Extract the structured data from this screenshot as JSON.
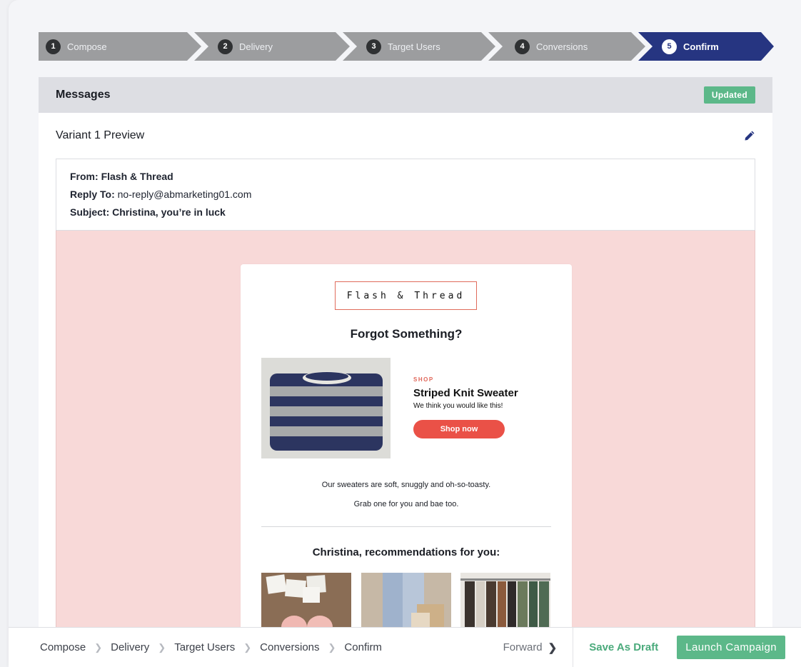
{
  "stepper": {
    "steps": [
      {
        "num": "1",
        "label": "Compose"
      },
      {
        "num": "2",
        "label": "Delivery"
      },
      {
        "num": "3",
        "label": "Target Users"
      },
      {
        "num": "4",
        "label": "Conversions"
      },
      {
        "num": "5",
        "label": "Confirm"
      }
    ],
    "active_step": 5,
    "colors": {
      "inactive": "#9c9d9f",
      "active": "#263581"
    }
  },
  "card": {
    "title": "Messages",
    "badge": "Updated",
    "variant_title": "Variant 1 Preview",
    "edit_icon": "pencil-icon"
  },
  "email_headers": {
    "from_label": "From:",
    "from_value": "Flash & Thread",
    "reply_to_label": "Reply To:",
    "reply_to_value": "no-reply@abmarketing01.com",
    "subject_label": "Subject:",
    "subject_value": "Christina, you’re in luck"
  },
  "email": {
    "logo": "Flash & Thread",
    "headline": "Forgot Something?",
    "product": {
      "eyebrow": "SHOP",
      "name": "Striped Knit Sweater",
      "description": "We think you would like this!",
      "cta": "Shop now"
    },
    "body_line1": "Our sweaters are soft, snuggly and oh-so-toasty.",
    "body_line2": "Grab one for you and bae too.",
    "recs_title": "Christina, recommendations for you:"
  },
  "bottom_bar": {
    "breadcrumbs": [
      "Compose",
      "Delivery",
      "Target Users",
      "Conversions",
      "Confirm"
    ],
    "forward": "Forward",
    "save_draft": "Save As Draft",
    "launch": "Launch Campaign"
  },
  "colors": {
    "accent_green": "#5cb889",
    "preview_bg": "#f8d9d8",
    "cta_red": "#ea5147",
    "active_step_blue": "#263581"
  }
}
